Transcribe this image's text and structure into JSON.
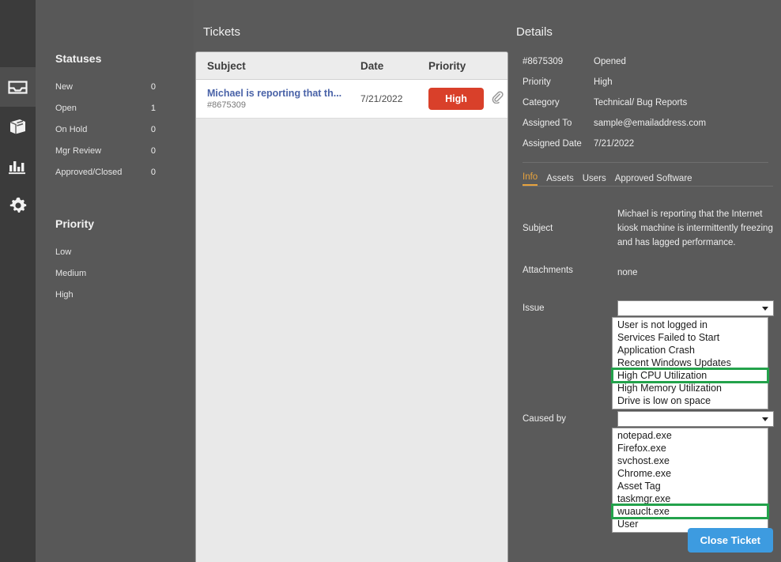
{
  "rail": {
    "items": [
      {
        "name": "inbox-icon",
        "label": "Inbox",
        "active": true
      },
      {
        "name": "knowledge-base-icon",
        "label": "Knowledge Base",
        "active": false
      },
      {
        "name": "reports-icon",
        "label": "Reports",
        "active": false
      },
      {
        "name": "settings-icon",
        "label": "Settings",
        "active": false
      }
    ]
  },
  "filters": {
    "statuses_title": "Statuses",
    "statuses": [
      {
        "label": "New",
        "count": "0"
      },
      {
        "label": "Open",
        "count": "1"
      },
      {
        "label": "On Hold",
        "count": "0"
      },
      {
        "label": "Mgr Review",
        "count": "0"
      },
      {
        "label": "Approved/Closed",
        "count": "0"
      }
    ],
    "priority_title": "Priority",
    "priorities": [
      {
        "label": "Low"
      },
      {
        "label": "Medium"
      },
      {
        "label": "High"
      }
    ]
  },
  "tickets": {
    "title": "Tickets",
    "columns": {
      "subject": "Subject",
      "date": "Date",
      "priority": "Priority"
    },
    "rows": [
      {
        "subject": "Michael is reporting that th...",
        "id": "#8675309",
        "date": "7/21/2022",
        "priority": "High",
        "priority_color": "#d9402a",
        "attachment_icon": "paperclip-icon"
      }
    ]
  },
  "details": {
    "title": "Details",
    "meta": [
      {
        "key": "#8675309",
        "value": "Opened"
      },
      {
        "key": "Priority",
        "value": "High"
      },
      {
        "key": "Category",
        "value": "Technical/ Bug Reports"
      },
      {
        "key": "Assigned To",
        "value": "sample@emailaddress.com"
      },
      {
        "key": "Assigned Date",
        "value": "7/21/2022"
      }
    ],
    "tabs": [
      {
        "label": "Info",
        "active": true
      },
      {
        "label": "Assets",
        "active": false
      },
      {
        "label": "Users",
        "active": false
      },
      {
        "label": "Approved Software",
        "active": false
      }
    ],
    "accent_color": "#e8a33d",
    "fields": {
      "subject_label": "Subject",
      "subject_value": "Michael is reporting that the Internet kiosk machine is intermittently freezing and has lagged performance.",
      "attachments_label": "Attachments",
      "attachments_value": "none"
    },
    "issue_dropdown": {
      "label": "Issue",
      "value": "",
      "placeholder": "",
      "options": [
        "User is not logged in",
        "Services Failed to Start",
        "Application Crash",
        "Recent Windows Updates",
        "High CPU Utilization",
        "High Memory Utilization",
        "Drive is low on space"
      ],
      "highlighted": "High CPU Utilization",
      "highlight_color": "#23a24b"
    },
    "caused_by_dropdown": {
      "label": "Caused by",
      "value": "",
      "placeholder": "",
      "options": [
        "notepad.exe",
        "Firefox.exe",
        "svchost.exe",
        "Chrome.exe",
        "Asset Tag",
        "taskmgr.exe",
        "wuauclt.exe",
        "User"
      ],
      "highlighted": "wuauclt.exe",
      "highlight_color": "#23a24b"
    },
    "close_button": "Close Ticket",
    "close_button_color": "#3d9be0"
  }
}
